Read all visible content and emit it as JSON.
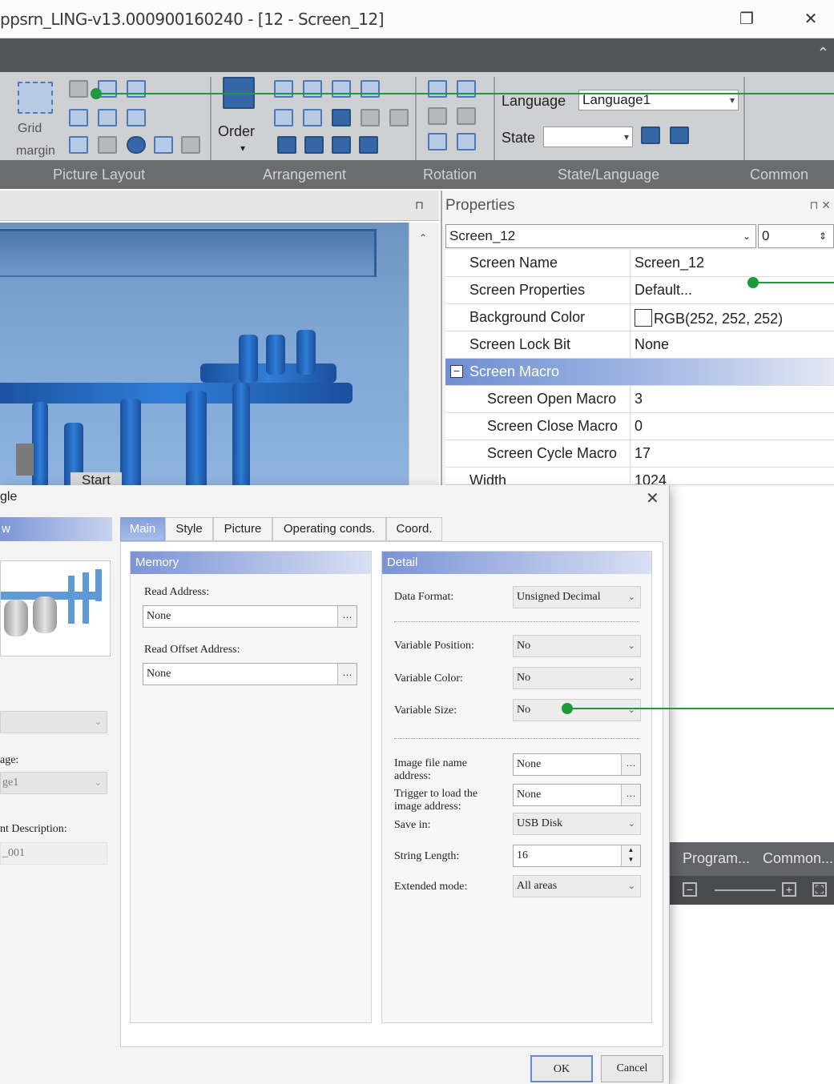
{
  "window": {
    "title": "ppsrn_LING-v13.000900160240 - [12 - Screen_12]",
    "restore_glyph": "❐",
    "close_glyph": "✕",
    "collapse_glyph": "⌃"
  },
  "ribbon": {
    "groups": [
      "Picture Layout",
      "Arrangement",
      "Rotation",
      "State/Language",
      "Common"
    ],
    "order_label": "Order",
    "grid_label": "Grid",
    "grid_label2": "margin",
    "language_label": "Language",
    "language_value": "Language1",
    "state_label": "State"
  },
  "canvas": {
    "start_label": "Start"
  },
  "properties": {
    "title": "Properties",
    "pin_glyph": "⊓ ✕",
    "object_combo": "Screen_12",
    "spin_value": "0",
    "rows": [
      {
        "key": "Screen Name",
        "value": "Screen_12"
      },
      {
        "key": "Screen Properties",
        "value": "Default..."
      },
      {
        "key": "Background Color",
        "value": "RGB(252, 252, 252)"
      },
      {
        "key": "Screen Lock Bit",
        "value": "None"
      }
    ],
    "section": "Screen Macro",
    "section_rows": [
      {
        "key": "Screen Open Macro",
        "value": "3"
      },
      {
        "key": "Screen Close Macro",
        "value": "0"
      },
      {
        "key": "Screen Cycle Macro",
        "value": "17"
      }
    ],
    "width_row": {
      "key": "Width",
      "value": "1024"
    }
  },
  "status": {
    "tab1": "Program...",
    "tab2": "Common..."
  },
  "dialog": {
    "title": "gle",
    "close_glyph": "✕",
    "left": {
      "head": "w",
      "language_label": "age:",
      "language_value": "ge1",
      "comment_label": "nt Description:",
      "comment_value": "_001"
    },
    "tabs": [
      "Main",
      "Style",
      "Picture",
      "Operating conds.",
      "Coord."
    ],
    "memory": {
      "head": "Memory",
      "read_address_label": "Read Address:",
      "read_address_value": "None",
      "read_offset_label": "Read Offset Address:",
      "read_offset_value": "None"
    },
    "detail": {
      "head": "Detail",
      "data_format_label": "Data Format:",
      "data_format_value": "Unsigned Decimal",
      "var_position_label": "Variable Position:",
      "var_position_value": "No",
      "var_color_label": "Variable Color:",
      "var_color_value": "No",
      "var_size_label": "Variable Size:",
      "var_size_value": "No",
      "image_file_label_1": "Image file name",
      "image_file_label_2": "address:",
      "image_file_value": "None",
      "trigger_label_1": "Trigger to load the",
      "trigger_label_2": "image address:",
      "trigger_value": "None",
      "save_in_label": "Save in:",
      "save_in_value": "USB Disk",
      "string_length_label": "String Length:",
      "string_length_value": "16",
      "extended_label": "Extended mode:",
      "extended_value": "All areas"
    },
    "ok_label": "OK",
    "cancel_label": "Cancel"
  },
  "colors": {
    "callout": "#1f9a3a",
    "accent": "#7b93d6"
  }
}
